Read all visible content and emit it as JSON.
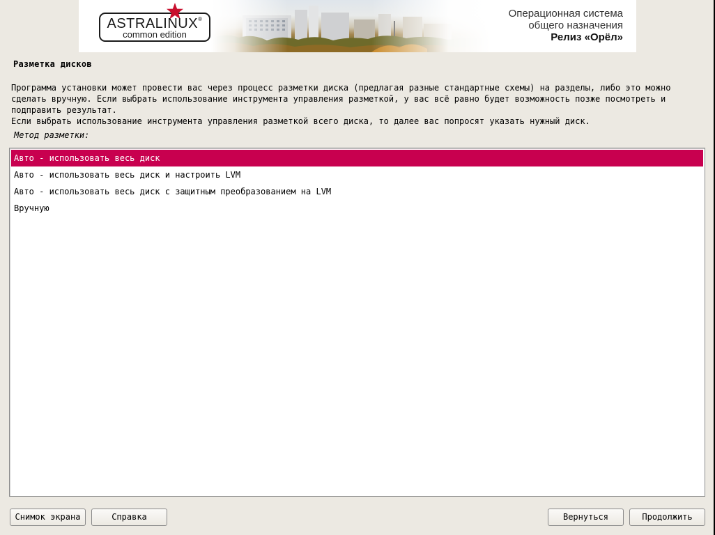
{
  "banner": {
    "logo_word": "ASTRALINUX",
    "logo_reg_mark": "®",
    "logo_subtitle": "common edition",
    "os_line1": "Операционная система",
    "os_line2": "общего назначения",
    "release": "Релиз «Орёл»",
    "accent_color": "#c8102e"
  },
  "page": {
    "title": "Разметка дисков",
    "paragraph1": "Программа установки может провести вас через процесс разметки диска (предлагая разные стандартные схемы) на разделы, либо это можно сделать вручную. Если выбрать использование инструмента управления разметкой, у вас всё равно будет возможность позже посмотреть и подправить результат.",
    "paragraph2": "Если выбрать использование инструмента управления разметкой всего диска, то далее вас попросят указать нужный диск.",
    "method_label": "Метод разметки:"
  },
  "methods": {
    "selected_color": "#c8004f",
    "items": [
      {
        "label": "Авто - использовать весь диск",
        "selected": true
      },
      {
        "label": "Авто - использовать весь диск и настроить LVM",
        "selected": false
      },
      {
        "label": "Авто - использовать весь диск с защитным преобразованием на LVM",
        "selected": false
      },
      {
        "label": "Вручную",
        "selected": false
      }
    ]
  },
  "buttons": {
    "screenshot": "Снимок экрана",
    "help": "Справка",
    "back": "Вернуться",
    "continue": "Продолжить"
  }
}
